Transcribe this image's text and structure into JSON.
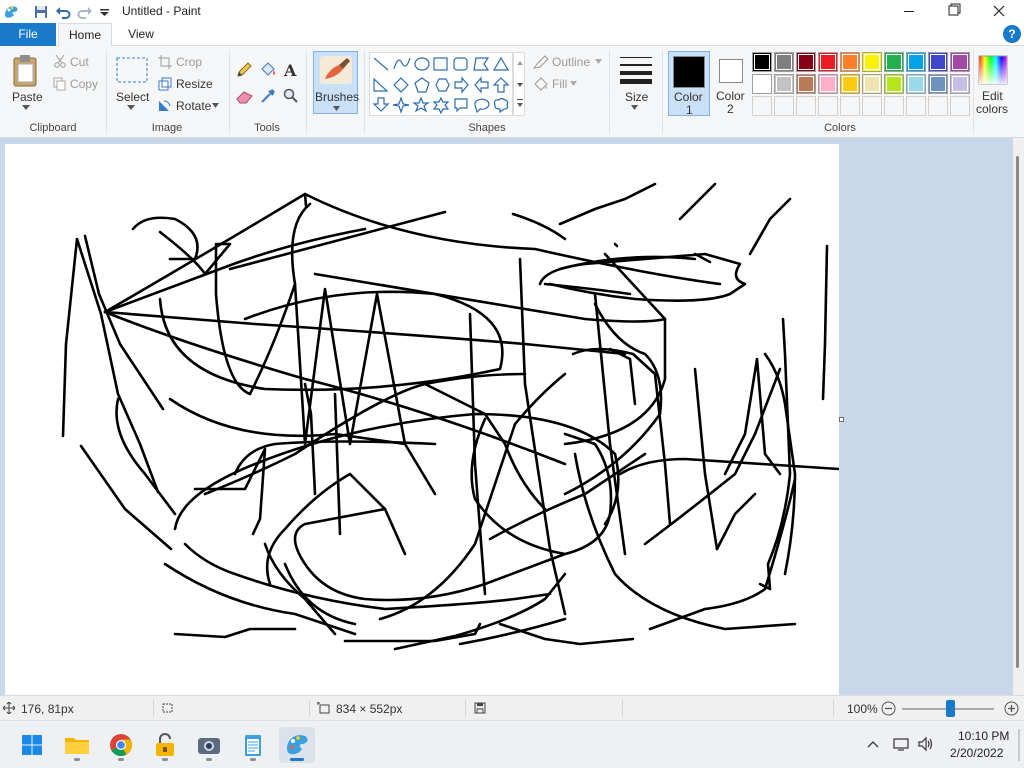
{
  "window": {
    "title": "Untitled - Paint"
  },
  "menu": {
    "file": "File",
    "home": "Home",
    "view": "View",
    "help": "?"
  },
  "ribbon": {
    "clipboard": {
      "label": "Clipboard",
      "paste": "Paste",
      "cut": "Cut",
      "copy": "Copy"
    },
    "image": {
      "label": "Image",
      "select": "Select",
      "crop": "Crop",
      "resize": "Resize",
      "rotate": "Rotate"
    },
    "tools": {
      "label": "Tools",
      "text_tool": "A"
    },
    "brushes": "Brushes",
    "shapes": {
      "label": "Shapes",
      "outline": "Outline",
      "fill": "Fill"
    },
    "size": "Size",
    "color1": {
      "line1": "Color",
      "line2": "1",
      "value": "#000000"
    },
    "color2": {
      "line1": "Color",
      "line2": "2",
      "value": "#ffffff"
    },
    "colors": {
      "label": "Colors",
      "edit_line1": "Edit",
      "edit_line2": "colors",
      "palette_row1": [
        "#000000",
        "#7f7f7f",
        "#880015",
        "#ed1c24",
        "#ff7f27",
        "#fff200",
        "#22b14c",
        "#00a2e8",
        "#3f48cc",
        "#a349a4"
      ],
      "palette_row2": [
        "#ffffff",
        "#c3c3c3",
        "#b97a57",
        "#ffaec9",
        "#ffc90e",
        "#efe4b0",
        "#b5e61d",
        "#99d9ea",
        "#7092be",
        "#c8bfe7"
      ]
    }
  },
  "status": {
    "cursor_pos": "176, 81px",
    "canvas_size": "834 × 552px",
    "zoom": "100%"
  },
  "taskbar": {
    "apps": [
      "start-icon",
      "file-explorer-icon",
      "chrome-icon",
      "lock-app-icon",
      "camera-icon",
      "notepad-icon",
      "paint-icon"
    ],
    "time": "10:10 PM",
    "date": "2/20/2022"
  }
}
